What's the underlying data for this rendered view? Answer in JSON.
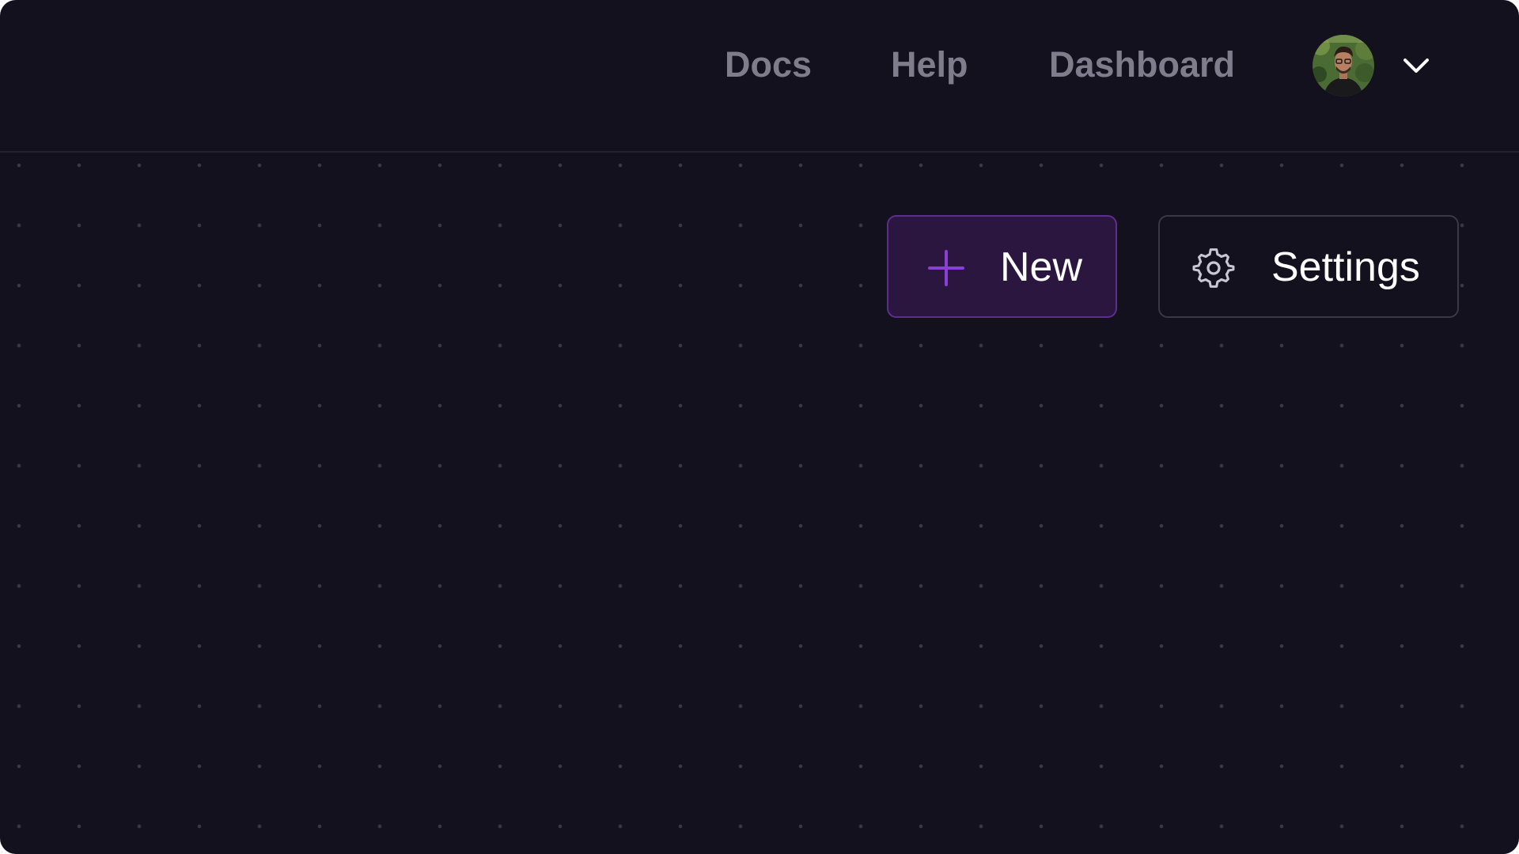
{
  "nav": {
    "links": [
      {
        "label": "Docs"
      },
      {
        "label": "Help"
      },
      {
        "label": "Dashboard"
      }
    ],
    "avatar_icon": "user-avatar",
    "menu_icon": "chevron-down-icon"
  },
  "toolbar": {
    "new_button": {
      "label": "New",
      "icon": "plus-icon"
    },
    "settings_button": {
      "label": "Settings",
      "icon": "gear-icon"
    }
  },
  "colors": {
    "background": "#13111d",
    "nav_text": "#7f7c8b",
    "accent": "#8b3fd6",
    "new_button_bg": "#2b1640"
  }
}
